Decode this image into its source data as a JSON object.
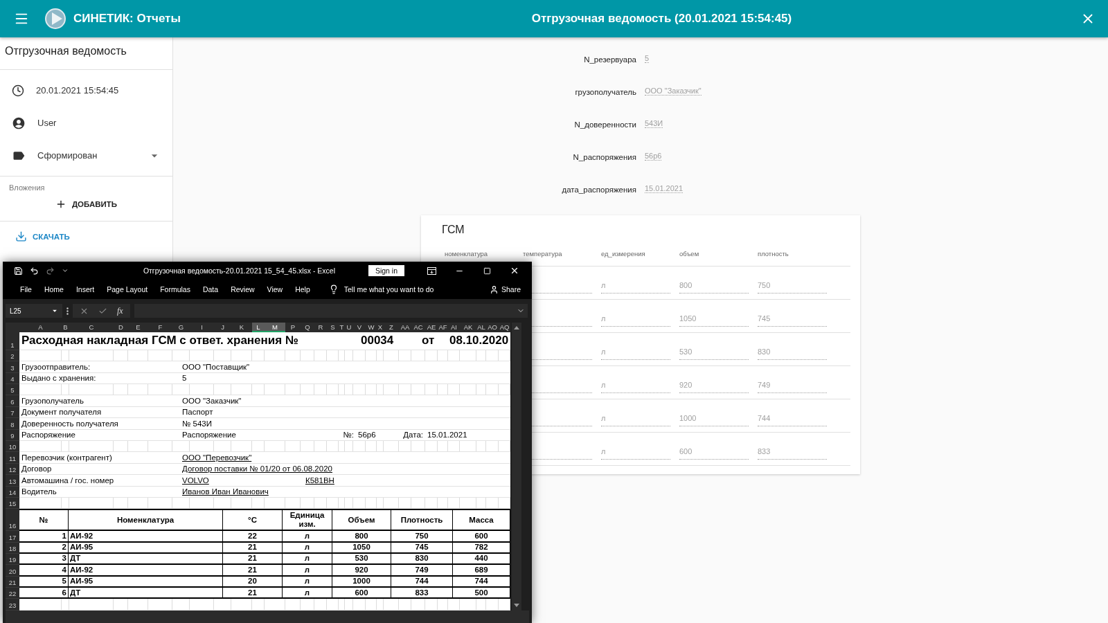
{
  "app_bar": {
    "title": "СИНЕТИК: Отчеты",
    "page_title": "Отгрузочная ведомость (20.01.2021 15:54:45)"
  },
  "sidebar": {
    "title": "Отгрузочная ведомость",
    "info": [
      {
        "kind": "time",
        "text": "20.01.2021 15:54:45"
      },
      {
        "kind": "user",
        "text": "User"
      },
      {
        "kind": "status",
        "text": "Сформирован"
      }
    ],
    "attachments_label": "Вложения",
    "add_button": "ДОБАВИТЬ",
    "download_button": "СКАЧАТЬ"
  },
  "form": {
    "fields": [
      {
        "label": "N_резервуара",
        "value": "5"
      },
      {
        "label": "грузополучатель",
        "value": "ООО \"Заказчик\""
      },
      {
        "label": "N_доверенности",
        "value": "543И"
      },
      {
        "label": "N_распоряжения",
        "value": "56р6"
      },
      {
        "label": "дата_распоряжения",
        "value": "15.01.2021"
      }
    ]
  },
  "gsm": {
    "title": "ГСМ",
    "columns": [
      "номенклатура",
      "температура",
      "ед_измерения",
      "объем",
      "плотность"
    ],
    "rows": [
      {
        "unit": "л",
        "volume": "800",
        "density": "750"
      },
      {
        "unit": "л",
        "volume": "1050",
        "density": "745"
      },
      {
        "unit": "л",
        "volume": "530",
        "density": "830"
      },
      {
        "unit": "л",
        "volume": "920",
        "density": "749"
      },
      {
        "unit": "л",
        "volume": "1000",
        "density": "744"
      },
      {
        "unit": "л",
        "volume": "600",
        "density": "833"
      }
    ]
  },
  "excel": {
    "window_title": "Отгрузочная ведомость-20.01.2021 15_54_45.xlsx  -  Excel",
    "sign_in": "Sign in",
    "menu": [
      "File",
      "Home",
      "Insert",
      "Page Layout",
      "Formulas",
      "Data",
      "Review",
      "View",
      "Help"
    ],
    "tell_me": "Tell me what you want to do",
    "share": "Share",
    "name_box": "L25",
    "fx": "fx",
    "columns": [
      {
        "label": "A",
        "selected": false
      },
      {
        "label": "B",
        "selected": false
      },
      {
        "label": "C",
        "selected": false
      },
      {
        "label": "D",
        "selected": false
      },
      {
        "label": "E",
        "selected": false
      },
      {
        "label": "F",
        "selected": false
      },
      {
        "label": "G",
        "selected": false
      },
      {
        "label": "I",
        "selected": false
      },
      {
        "label": "J",
        "selected": false
      },
      {
        "label": "K",
        "selected": false
      },
      {
        "label": "L",
        "selected": true
      },
      {
        "label": "M",
        "selected": true
      },
      {
        "label": "P",
        "selected": false
      },
      {
        "label": "Q",
        "selected": false
      },
      {
        "label": "R",
        "selected": false
      },
      {
        "label": "S",
        "selected": false
      },
      {
        "label": "T",
        "selected": false
      },
      {
        "label": "U",
        "selected": false
      },
      {
        "label": "V",
        "selected": false
      },
      {
        "label": "W",
        "selected": false
      },
      {
        "label": "X",
        "selected": false
      },
      {
        "label": "Z",
        "selected": false
      },
      {
        "label": "AA",
        "selected": false
      },
      {
        "label": "AC",
        "selected": false
      },
      {
        "label": "AE",
        "selected": false
      },
      {
        "label": "AF",
        "selected": false
      },
      {
        "label": "AI",
        "selected": false
      },
      {
        "label": "AK",
        "selected": false
      },
      {
        "label": "AL",
        "selected": false
      },
      {
        "label": "AO",
        "selected": false
      },
      {
        "label": "AQ",
        "selected": false
      }
    ],
    "rows": [
      {
        "num": "1",
        "kind": "title",
        "cells": [
          "Расходная накладная ГСМ с ответ. хранения №",
          "00034",
          "от",
          "08.10.2020"
        ]
      },
      {
        "num": "2",
        "kind": "blank"
      },
      {
        "num": "3",
        "kind": "field",
        "underlined": false,
        "cells": [
          "Грузоотправитель:",
          "ООО \"Поставщик\""
        ]
      },
      {
        "num": "4",
        "kind": "field",
        "underlined": false,
        "cells": [
          "Выдано с хранения:",
          "5"
        ]
      },
      {
        "num": "5",
        "kind": "blank"
      },
      {
        "num": "6",
        "kind": "field",
        "underlined": false,
        "cells": [
          "Грузополучатель",
          "ООО \"Заказчик\""
        ]
      },
      {
        "num": "7",
        "kind": "field",
        "underlined": false,
        "cells": [
          "Документ получателя",
          "Паспорт"
        ]
      },
      {
        "num": "8",
        "kind": "field",
        "underlined": false,
        "cells": [
          "Доверенность получателя",
          "№ 543И"
        ]
      },
      {
        "num": "9",
        "kind": "order",
        "cells": [
          "Распоряжение",
          "Распоряжение",
          "№:",
          "56р6",
          "Дата:",
          "15.01.2021"
        ]
      },
      {
        "num": "10",
        "kind": "blank"
      },
      {
        "num": "11",
        "kind": "field",
        "underlined": true,
        "cells": [
          "Перевозчик (контрагент)",
          "ООО \"Перевозчик\""
        ]
      },
      {
        "num": "12",
        "kind": "field",
        "underlined": true,
        "cells": [
          "Договор",
          "Договор поставки № 01/20 от 06.08.2020"
        ]
      },
      {
        "num": "13",
        "kind": "vehicle",
        "underlined": true,
        "cells": [
          "Автомашина / гос. номер",
          "VOLVO",
          "К581ВН"
        ]
      },
      {
        "num": "14",
        "kind": "field",
        "underlined": true,
        "cells": [
          "Водитель",
          "Иванов Иван Иванович"
        ]
      },
      {
        "num": "15",
        "kind": "blank"
      },
      {
        "num": "16",
        "kind": "table_header",
        "cells": [
          "№",
          "Номенклатура",
          "°C",
          "Единица изм.",
          "Объем",
          "Плотность",
          "Масса"
        ]
      },
      {
        "num": "17",
        "kind": "table_row",
        "cells": [
          "1",
          "АИ-92",
          "22",
          "л",
          "800",
          "750",
          "600"
        ]
      },
      {
        "num": "18",
        "kind": "table_row",
        "cells": [
          "2",
          "АИ-95",
          "21",
          "л",
          "1050",
          "745",
          "782"
        ]
      },
      {
        "num": "19",
        "kind": "table_row",
        "cells": [
          "3",
          "ДТ",
          "21",
          "л",
          "530",
          "830",
          "440"
        ]
      },
      {
        "num": "20",
        "kind": "table_row",
        "cells": [
          "4",
          "АИ-92",
          "21",
          "л",
          "920",
          "749",
          "689"
        ]
      },
      {
        "num": "21",
        "kind": "table_row",
        "cells": [
          "5",
          "АИ-95",
          "20",
          "л",
          "1000",
          "744",
          "744"
        ]
      },
      {
        "num": "22",
        "kind": "table_row",
        "cells": [
          "6",
          "ДТ",
          "21",
          "л",
          "600",
          "833",
          "500"
        ]
      },
      {
        "num": "23",
        "kind": "blank"
      }
    ]
  }
}
